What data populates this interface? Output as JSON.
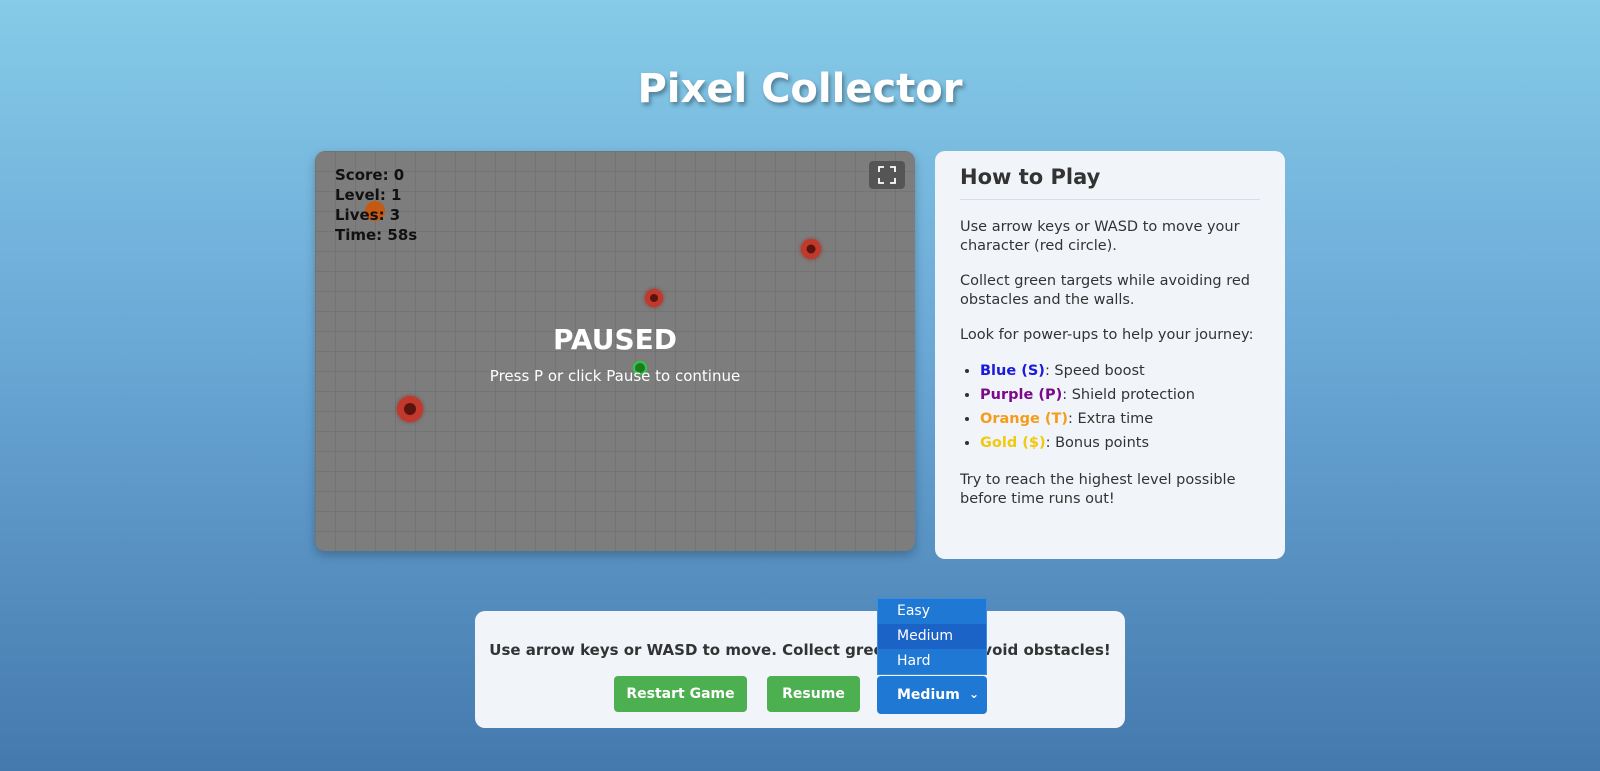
{
  "title": "Pixel Collector",
  "hud": {
    "score": "Score: 0",
    "level": "Level: 1",
    "lives": "Lives: 3",
    "time": "Time: 58s"
  },
  "overlay": {
    "title": "PAUSED",
    "subtitle": "Press P or click Pause to continue"
  },
  "icons": {
    "fullscreen": "fullscreen-icon"
  },
  "colors": {
    "obstacle": "#c0392b",
    "target": "#2ecc40",
    "button": "#4caf50",
    "select": "#1e78d4",
    "blue": "#1a1adb",
    "purple": "#7b0a8a",
    "orange": "#f59c1a",
    "gold": "#f2c811"
  },
  "how_to_play": {
    "heading": "How to Play",
    "p1": "Use arrow keys or WASD to move your character (red circle).",
    "p2": "Collect green targets while avoiding red obstacles and the walls.",
    "p3": "Look for power-ups to help your journey:",
    "powerups": [
      {
        "name": "Blue (S)",
        "desc": ": Speed boost"
      },
      {
        "name": "Purple (P)",
        "desc": ": Shield protection"
      },
      {
        "name": "Orange (T)",
        "desc": ": Extra time"
      },
      {
        "name": "Gold ($)",
        "desc": ": Bonus points"
      }
    ],
    "p4": "Try to reach the highest level possible before time runs out!"
  },
  "controls": {
    "instructions": "Use arrow keys or WASD to move. Collect green targets, avoid obstacles!",
    "restart_label": "Restart Game",
    "resume_label": "Resume",
    "difficulty_selected": "Medium",
    "difficulty_options": [
      "Easy",
      "Medium",
      "Hard"
    ]
  }
}
